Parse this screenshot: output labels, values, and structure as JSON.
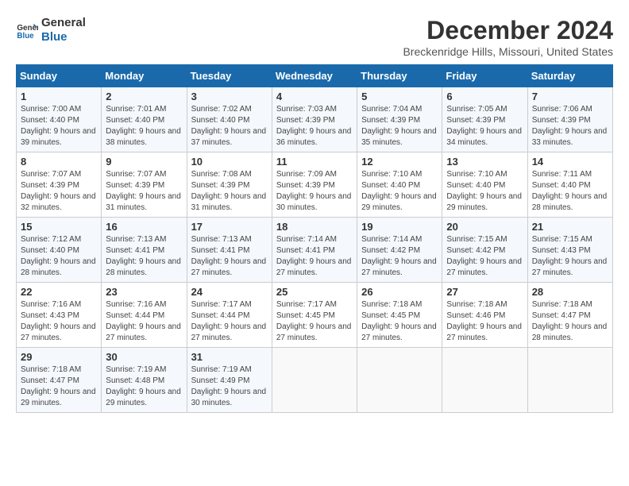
{
  "logo": {
    "text_general": "General",
    "text_blue": "Blue"
  },
  "header": {
    "title": "December 2024",
    "subtitle": "Breckenridge Hills, Missouri, United States"
  },
  "weekdays": [
    "Sunday",
    "Monday",
    "Tuesday",
    "Wednesday",
    "Thursday",
    "Friday",
    "Saturday"
  ],
  "weeks": [
    [
      {
        "day": "1",
        "sunrise": "7:00 AM",
        "sunset": "4:40 PM",
        "daylight": "9 hours and 39 minutes."
      },
      {
        "day": "2",
        "sunrise": "7:01 AM",
        "sunset": "4:40 PM",
        "daylight": "9 hours and 38 minutes."
      },
      {
        "day": "3",
        "sunrise": "7:02 AM",
        "sunset": "4:40 PM",
        "daylight": "9 hours and 37 minutes."
      },
      {
        "day": "4",
        "sunrise": "7:03 AM",
        "sunset": "4:39 PM",
        "daylight": "9 hours and 36 minutes."
      },
      {
        "day": "5",
        "sunrise": "7:04 AM",
        "sunset": "4:39 PM",
        "daylight": "9 hours and 35 minutes."
      },
      {
        "day": "6",
        "sunrise": "7:05 AM",
        "sunset": "4:39 PM",
        "daylight": "9 hours and 34 minutes."
      },
      {
        "day": "7",
        "sunrise": "7:06 AM",
        "sunset": "4:39 PM",
        "daylight": "9 hours and 33 minutes."
      }
    ],
    [
      {
        "day": "8",
        "sunrise": "7:07 AM",
        "sunset": "4:39 PM",
        "daylight": "9 hours and 32 minutes."
      },
      {
        "day": "9",
        "sunrise": "7:07 AM",
        "sunset": "4:39 PM",
        "daylight": "9 hours and 31 minutes."
      },
      {
        "day": "10",
        "sunrise": "7:08 AM",
        "sunset": "4:39 PM",
        "daylight": "9 hours and 31 minutes."
      },
      {
        "day": "11",
        "sunrise": "7:09 AM",
        "sunset": "4:39 PM",
        "daylight": "9 hours and 30 minutes."
      },
      {
        "day": "12",
        "sunrise": "7:10 AM",
        "sunset": "4:40 PM",
        "daylight": "9 hours and 29 minutes."
      },
      {
        "day": "13",
        "sunrise": "7:10 AM",
        "sunset": "4:40 PM",
        "daylight": "9 hours and 29 minutes."
      },
      {
        "day": "14",
        "sunrise": "7:11 AM",
        "sunset": "4:40 PM",
        "daylight": "9 hours and 28 minutes."
      }
    ],
    [
      {
        "day": "15",
        "sunrise": "7:12 AM",
        "sunset": "4:40 PM",
        "daylight": "9 hours and 28 minutes."
      },
      {
        "day": "16",
        "sunrise": "7:13 AM",
        "sunset": "4:41 PM",
        "daylight": "9 hours and 28 minutes."
      },
      {
        "day": "17",
        "sunrise": "7:13 AM",
        "sunset": "4:41 PM",
        "daylight": "9 hours and 27 minutes."
      },
      {
        "day": "18",
        "sunrise": "7:14 AM",
        "sunset": "4:41 PM",
        "daylight": "9 hours and 27 minutes."
      },
      {
        "day": "19",
        "sunrise": "7:14 AM",
        "sunset": "4:42 PM",
        "daylight": "9 hours and 27 minutes."
      },
      {
        "day": "20",
        "sunrise": "7:15 AM",
        "sunset": "4:42 PM",
        "daylight": "9 hours and 27 minutes."
      },
      {
        "day": "21",
        "sunrise": "7:15 AM",
        "sunset": "4:43 PM",
        "daylight": "9 hours and 27 minutes."
      }
    ],
    [
      {
        "day": "22",
        "sunrise": "7:16 AM",
        "sunset": "4:43 PM",
        "daylight": "9 hours and 27 minutes."
      },
      {
        "day": "23",
        "sunrise": "7:16 AM",
        "sunset": "4:44 PM",
        "daylight": "9 hours and 27 minutes."
      },
      {
        "day": "24",
        "sunrise": "7:17 AM",
        "sunset": "4:44 PM",
        "daylight": "9 hours and 27 minutes."
      },
      {
        "day": "25",
        "sunrise": "7:17 AM",
        "sunset": "4:45 PM",
        "daylight": "9 hours and 27 minutes."
      },
      {
        "day": "26",
        "sunrise": "7:18 AM",
        "sunset": "4:45 PM",
        "daylight": "9 hours and 27 minutes."
      },
      {
        "day": "27",
        "sunrise": "7:18 AM",
        "sunset": "4:46 PM",
        "daylight": "9 hours and 27 minutes."
      },
      {
        "day": "28",
        "sunrise": "7:18 AM",
        "sunset": "4:47 PM",
        "daylight": "9 hours and 28 minutes."
      }
    ],
    [
      {
        "day": "29",
        "sunrise": "7:18 AM",
        "sunset": "4:47 PM",
        "daylight": "9 hours and 29 minutes."
      },
      {
        "day": "30",
        "sunrise": "7:19 AM",
        "sunset": "4:48 PM",
        "daylight": "9 hours and 29 minutes."
      },
      {
        "day": "31",
        "sunrise": "7:19 AM",
        "sunset": "4:49 PM",
        "daylight": "9 hours and 30 minutes."
      },
      null,
      null,
      null,
      null
    ]
  ],
  "labels": {
    "sunrise": "Sunrise:",
    "sunset": "Sunset:",
    "daylight": "Daylight:"
  }
}
